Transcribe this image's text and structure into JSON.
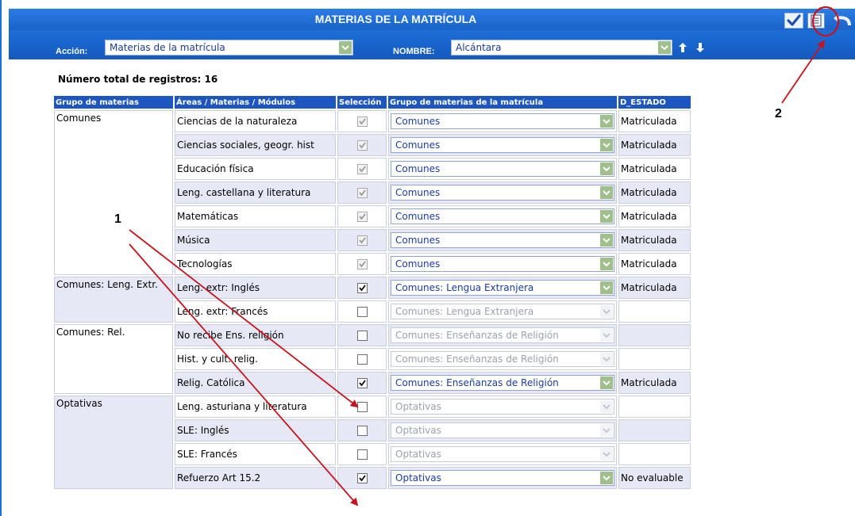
{
  "window": {
    "title": "MATERIAS DE LA MATRÍCULA"
  },
  "toolbar": {
    "accept_icon": "check-icon",
    "report_icon": "document-icon",
    "back_icon": "return-icon"
  },
  "filters": {
    "accion_label": "Acción:",
    "accion_value": "Materias de la matrícula",
    "nombre_label": "NOMBRE:",
    "nombre_value": "Alcántara"
  },
  "count_text": "Número total de registros: 16",
  "table": {
    "headers": [
      "Grupo de materias",
      "Áreas / Materias / Módulos",
      "Selección",
      "Grupo de materias de la matrícula",
      "D_ESTADO"
    ],
    "groups": [
      {
        "name": "Comunes",
        "rows": [
          {
            "materia": "Ciencias de la naturaleza",
            "checked": true,
            "enabled": false,
            "grupo": "Comunes",
            "estado": "Matriculada"
          },
          {
            "materia": "Ciencias sociales, geogr. hist",
            "checked": true,
            "enabled": false,
            "grupo": "Comunes",
            "estado": "Matriculada"
          },
          {
            "materia": "Educación física",
            "checked": true,
            "enabled": false,
            "grupo": "Comunes",
            "estado": "Matriculada"
          },
          {
            "materia": "Leng. castellana y literatura",
            "checked": true,
            "enabled": false,
            "grupo": "Comunes",
            "estado": "Matriculada"
          },
          {
            "materia": "Matemáticas",
            "checked": true,
            "enabled": false,
            "grupo": "Comunes",
            "estado": "Matriculada"
          },
          {
            "materia": "Música",
            "checked": true,
            "enabled": false,
            "grupo": "Comunes",
            "estado": "Matriculada"
          },
          {
            "materia": "Tecnologías",
            "checked": true,
            "enabled": false,
            "grupo": "Comunes",
            "estado": "Matriculada"
          }
        ]
      },
      {
        "name": "Comunes: Leng. Extr.",
        "rows": [
          {
            "materia": "Leng. extr: Inglés",
            "checked": true,
            "enabled": true,
            "grupo": "Comunes: Lengua Extranjera",
            "estado": "Matriculada"
          },
          {
            "materia": "Leng. extr: Francés",
            "checked": false,
            "enabled": true,
            "grupo": "Comunes: Lengua Extranjera",
            "estado": ""
          }
        ]
      },
      {
        "name": "Comunes: Rel.",
        "rows": [
          {
            "materia": "No recibe Ens. religión",
            "checked": false,
            "enabled": true,
            "grupo": "Comunes: Enseñanzas de Religión",
            "estado": ""
          },
          {
            "materia": "Hist. y cult. relig.",
            "checked": false,
            "enabled": true,
            "grupo": "Comunes: Enseñanzas de Religión",
            "estado": ""
          },
          {
            "materia": "Relig. Católica",
            "checked": true,
            "enabled": true,
            "grupo": "Comunes: Enseñanzas de Religión",
            "estado": "Matriculada"
          }
        ]
      },
      {
        "name": "Optativas",
        "rows": [
          {
            "materia": "Leng. asturiana y literatura",
            "checked": false,
            "enabled": true,
            "grupo": "Optativas",
            "estado": ""
          },
          {
            "materia": "SLE: Inglés",
            "checked": false,
            "enabled": true,
            "grupo": "Optativas",
            "estado": ""
          },
          {
            "materia": "SLE: Francés",
            "checked": false,
            "enabled": true,
            "grupo": "Optativas",
            "estado": ""
          },
          {
            "materia": "Refuerzo Art 15.2",
            "checked": true,
            "enabled": true,
            "grupo": "Optativas",
            "estado": "No evaluable"
          }
        ]
      }
    ]
  },
  "annotations": {
    "label_1": "1",
    "label_2": "2",
    "arrow_color": "#c8121c"
  }
}
